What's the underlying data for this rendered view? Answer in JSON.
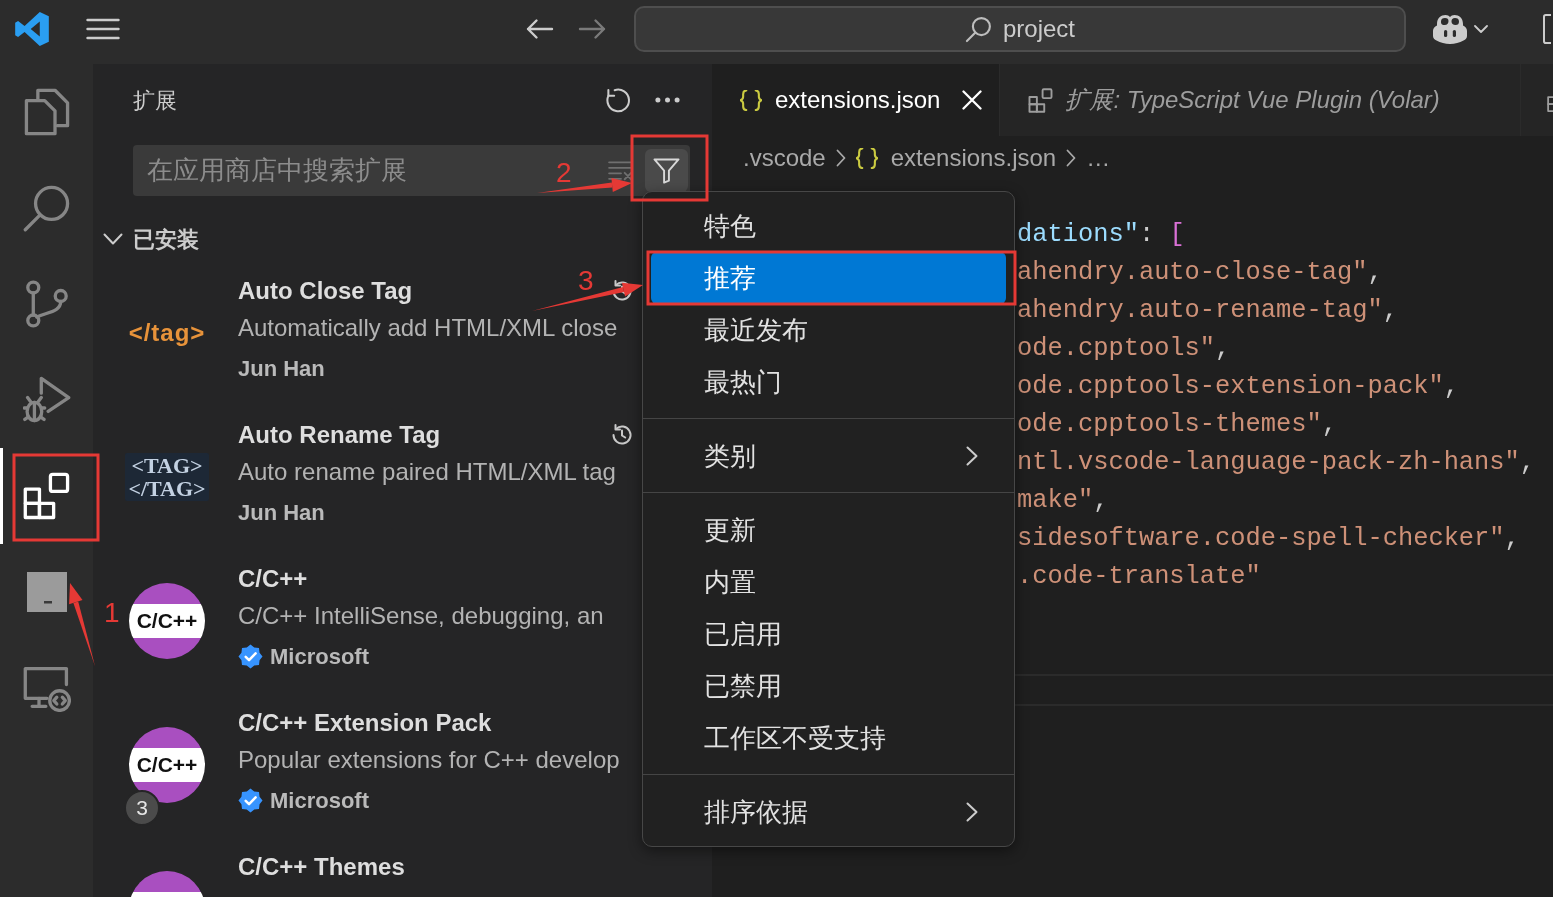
{
  "title_bar": {
    "nav": [
      {
        "kind": "back",
        "disabled": false
      },
      {
        "kind": "forward",
        "disabled": true
      }
    ],
    "command_center": {
      "label": "project"
    }
  },
  "activity_bar": {
    "items": [
      {
        "kind": "explorer",
        "selected": false
      },
      {
        "kind": "search",
        "selected": false
      },
      {
        "kind": "source-control",
        "selected": false
      },
      {
        "kind": "run-debug",
        "selected": false
      },
      {
        "kind": "extensions",
        "selected": true
      },
      {
        "kind": "block",
        "selected": false
      },
      {
        "kind": "remote",
        "selected": false
      }
    ]
  },
  "sidebar": {
    "title": "扩展",
    "search": {
      "placeholder": "在应用商店中搜索扩展"
    },
    "section": {
      "title": "已安装",
      "expanded": true
    },
    "extensions": [
      {
        "name": "Auto Close Tag",
        "description": "Automatically add HTML/XML close",
        "publisher": "Jun Han",
        "verified": false,
        "history": true,
        "logo": {
          "kind": "tag",
          "lines": [
            "</tag>"
          ]
        }
      },
      {
        "name": "Auto Rename Tag",
        "description": "Auto rename paired HTML/XML tag",
        "publisher": "Jun Han",
        "verified": false,
        "history": true,
        "logo": {
          "kind": "chalk",
          "lines": [
            "<TAG>",
            "</TAG>"
          ]
        }
      },
      {
        "name": "C/C++",
        "description": "C/C++ IntelliSense, debugging, an",
        "publisher": "Microsoft",
        "verified": true,
        "history": false,
        "logo": {
          "kind": "cpp",
          "lines": [
            "C/C++"
          ]
        }
      },
      {
        "name": "C/C++ Extension Pack",
        "description": "Popular extensions for C++ develop",
        "publisher": "Microsoft",
        "verified": true,
        "history": false,
        "badge": "3",
        "logo": {
          "kind": "cpp",
          "lines": [
            "C/C++"
          ]
        }
      },
      {
        "name": "C/C++ Themes",
        "verified": false,
        "history": false,
        "logo": {
          "kind": "cpp"
        }
      }
    ]
  },
  "filter_menu": {
    "groups": [
      {
        "items": [
          {
            "label": "特色",
            "selected": false,
            "submenu": false
          },
          {
            "label": "推荐",
            "selected": true,
            "submenu": false
          },
          {
            "label": "最近发布",
            "selected": false,
            "submenu": false
          },
          {
            "label": "最热门",
            "selected": false,
            "submenu": false
          }
        ]
      },
      {
        "items": [
          {
            "label": "类别",
            "selected": false,
            "submenu": true
          }
        ]
      },
      {
        "items": [
          {
            "label": "更新",
            "selected": false,
            "submenu": false
          },
          {
            "label": "内置",
            "selected": false,
            "submenu": false
          },
          {
            "label": "已启用",
            "selected": false,
            "submenu": false
          },
          {
            "label": "已禁用",
            "selected": false,
            "submenu": false
          },
          {
            "label": "工作区不受支持",
            "selected": false,
            "submenu": false
          }
        ]
      },
      {
        "items": [
          {
            "label": "排序依据",
            "selected": false,
            "submenu": true
          }
        ]
      }
    ]
  },
  "editor": {
    "tabs": [
      {
        "kind": "json",
        "label": "extensions.json",
        "selected": true,
        "preview": false
      },
      {
        "kind": "extension",
        "label": "扩展: TypeScript Vue Plugin (Volar)",
        "selected": false,
        "preview": true
      },
      {
        "kind": "extension",
        "selected": false
      }
    ],
    "breadcrumbs": [
      {
        "kind": "folder",
        "label": ".vscode"
      },
      {
        "kind": "json",
        "label": "extensions.json"
      },
      {
        "kind": "more",
        "label": "…"
      }
    ],
    "code_lines": [
      {
        "tokens": [
          {
            "kind": "key",
            "text": "dations\""
          },
          {
            "kind": "punct",
            "text": ": "
          },
          {
            "kind": "bracket",
            "text": "["
          }
        ]
      },
      {
        "tokens": [
          {
            "kind": "string",
            "text": "ahendry.auto-close-tag\""
          },
          {
            "kind": "punct",
            "text": ","
          }
        ]
      },
      {
        "tokens": [
          {
            "kind": "string",
            "text": "ahendry.auto-rename-tag\""
          },
          {
            "kind": "punct",
            "text": ","
          }
        ]
      },
      {
        "tokens": [
          {
            "kind": "string",
            "text": "ode.cpptools\""
          },
          {
            "kind": "punct",
            "text": ","
          }
        ]
      },
      {
        "tokens": [
          {
            "kind": "string",
            "text": "ode.cpptools-extension-pack\""
          },
          {
            "kind": "punct",
            "text": ","
          }
        ]
      },
      {
        "tokens": [
          {
            "kind": "string",
            "text": "ode.cpptools-themes\""
          },
          {
            "kind": "punct",
            "text": ","
          }
        ]
      },
      {
        "tokens": [
          {
            "kind": "string",
            "text": "ntl.vscode-language-pack-zh-hans\""
          },
          {
            "kind": "punct",
            "text": ","
          }
        ]
      },
      {
        "tokens": [
          {
            "kind": "string",
            "text": "make\""
          },
          {
            "kind": "punct",
            "text": ","
          }
        ]
      },
      {
        "tokens": [
          {
            "kind": "string",
            "text": "sidesoftware.code-spell-checker\""
          },
          {
            "kind": "punct",
            "text": ","
          }
        ]
      },
      {
        "tokens": [
          {
            "kind": "string",
            "text": ".code-translate\""
          }
        ]
      }
    ]
  },
  "annotations": [
    {
      "kind": "box"
    },
    {
      "kind": "box"
    },
    {
      "kind": "box"
    },
    {
      "kind": "arrow",
      "number": "1"
    },
    {
      "kind": "arrow",
      "number": "2"
    },
    {
      "kind": "arrow",
      "number": "3"
    }
  ]
}
